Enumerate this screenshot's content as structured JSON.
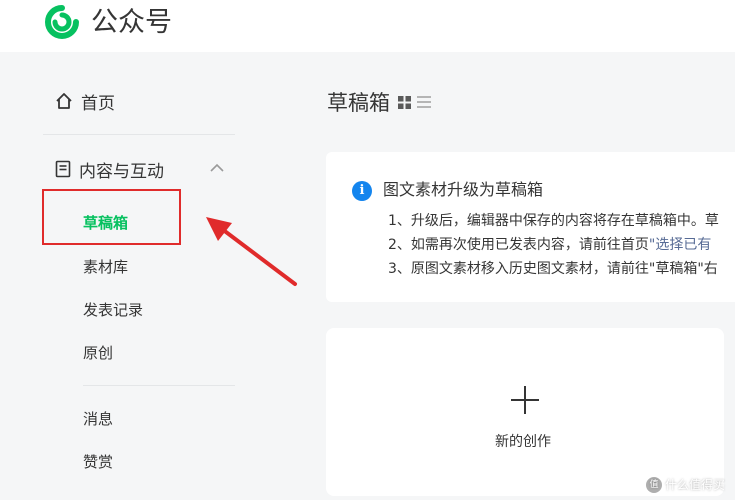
{
  "app": {
    "brand": "公众号",
    "brand_color": "#07c160"
  },
  "sidebar": {
    "home": {
      "label": "首页",
      "icon": "home-icon"
    },
    "content_group": {
      "label": "内容与互动",
      "icon": "document-icon",
      "expanded": true
    },
    "sub_items": [
      {
        "label": "草稿箱",
        "active": true
      },
      {
        "label": "素材库"
      },
      {
        "label": "发表记录"
      },
      {
        "label": "原创"
      },
      {
        "label": "消息"
      },
      {
        "label": "赞赏"
      }
    ]
  },
  "main": {
    "title": "草稿箱",
    "notice": {
      "title": "图文素材升级为草稿箱",
      "lines": [
        {
          "text": "1、升级后，编辑器中保存的内容将存在草稿箱中。草"
        },
        {
          "text": "2、如需再次使用已发表内容，请前往首页",
          "link": "\"选择已有"
        },
        {
          "text": "3、原图文素材移入历史图文素材，请前往\"草稿箱\"右"
        }
      ]
    },
    "new_card": {
      "label": "新的创作"
    }
  },
  "annotation": {
    "color": "#e02b2b"
  },
  "watermark": {
    "badge": "值",
    "text": "什么值得买"
  },
  "colors": {
    "accent": "#07c160",
    "info": "#1485ee",
    "link": "#576b95"
  }
}
